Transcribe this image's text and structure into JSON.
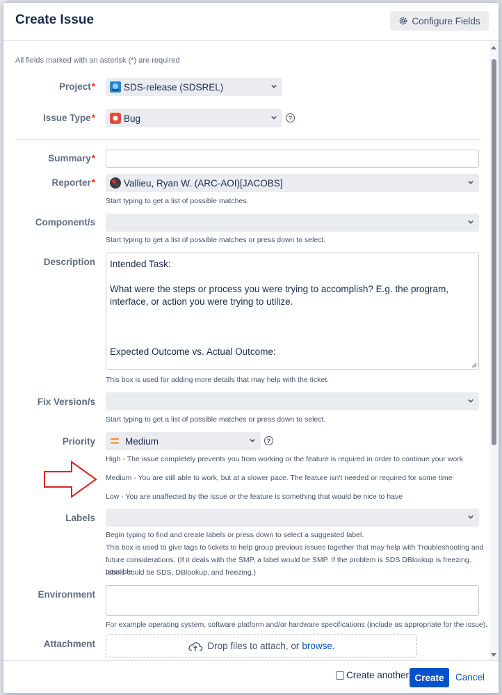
{
  "dialog": {
    "title": "Create Issue",
    "configure_label": "Configure Fields",
    "required_note": "All fields marked with an asterisk (*) are required"
  },
  "fields": {
    "project": {
      "label": "Project",
      "value": "SDS-release (SDSREL)"
    },
    "issue_type": {
      "label": "Issue Type",
      "value": "Bug"
    },
    "summary": {
      "label": "Summary",
      "value": ""
    },
    "reporter": {
      "label": "Reporter",
      "value": "Vallieu, Ryan W. (ARC-AOI)[JACOBS]",
      "help": "Start typing to get a list of possible matches."
    },
    "components": {
      "label": "Component/s",
      "value": "",
      "help": "Start typing to get a list of possible matches or press down to select."
    },
    "description": {
      "label": "Description",
      "lines": [
        "Intended Task:",
        "",
        "What were the steps or process you were trying to accomplish? E.g. the program, interface, or action you were trying to utilize.",
        "",
        "",
        "",
        "Expected Outcome vs. Actual Outcome:"
      ],
      "help": "This box is used for adding more details that may help with the ticket."
    },
    "fix_version": {
      "label": "Fix Version/s",
      "value": "",
      "help": "Start typing to get a list of possible matches or press down to select."
    },
    "priority": {
      "label": "Priority",
      "value": "Medium",
      "help_high": "High - The issue completely prevents you from working or the feature is required in order to continue your work",
      "help_medium": "Medium - You are still able to work, but at a slower pace. The feature isn't needed or required for some time",
      "help_low": "Low - You are unaffected by the issue or the feature is something that would be nice to have"
    },
    "labels": {
      "label": "Labels",
      "value": "",
      "help_1": "Begin typing to find and create labels or press down to select a suggested label.",
      "help_2": "This box is used to give tags to tickets to help group previous issues together that may help with Troubleshooting and",
      "help_3": "future considerations. (If it deals with the SMP, a label would be SMP. If the problem is SDS DBlookup is freezing, possible",
      "help_4": "labels could be SDS, DBlookup, and freezing.)"
    },
    "environment": {
      "label": "Environment",
      "value": "",
      "help": "For example operating system, software platform and/or hardware specifications (include as appropriate for the issue)."
    },
    "attachment": {
      "label": "Attachment",
      "drop_text": "Drop files to attach, or",
      "browse_text": "browse."
    }
  },
  "footer": {
    "create_another_label": "Create another",
    "create_another_checked": false,
    "create_label": "Create",
    "cancel_label": "Cancel"
  },
  "icons": {
    "configure": "gear-icon",
    "project": "project-avatar-icon",
    "issue_type": "bug-icon",
    "reporter": "user-avatar-icon",
    "priority": "priority-medium-icon",
    "help": "question-circle-icon",
    "attachment": "cloud-upload-icon",
    "annotation": "red-arrow-icon"
  },
  "colors": {
    "accent": "#0052cc",
    "required": "#de350b",
    "bug": "#e5493a",
    "priority_medium": "#f79232",
    "annotation_arrow": "#e02020"
  }
}
